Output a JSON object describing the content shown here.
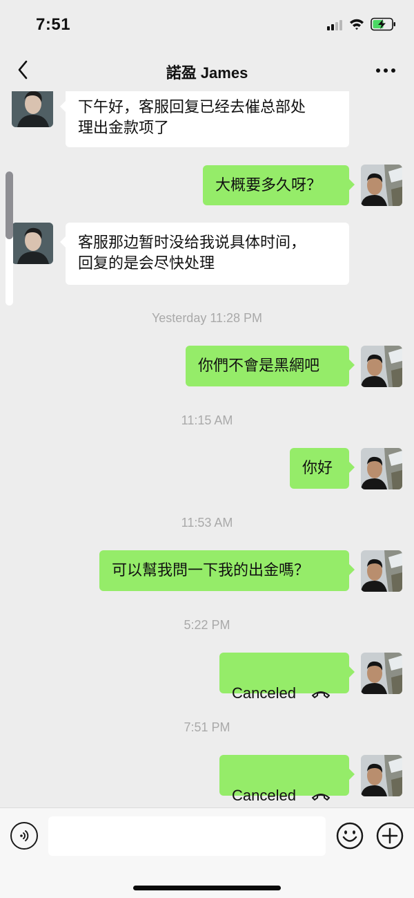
{
  "status_bar": {
    "time": "7:51"
  },
  "header": {
    "title": "諾盈 James"
  },
  "messages": [
    {
      "direction": "incoming",
      "text": "下午好，客服回复已经去催总部处\n理出金款项了"
    },
    {
      "direction": "outgoing",
      "text": "大概要多久呀？"
    },
    {
      "direction": "incoming",
      "text": "客服那边暂时没给我说具体时间，\n回复的是会尽快处理"
    },
    {
      "type": "timestamp",
      "text": "Yesterday 11:28 PM"
    },
    {
      "direction": "outgoing",
      "text": "你們不會是黑網吧"
    },
    {
      "type": "timestamp",
      "text": "11:15 AM"
    },
    {
      "direction": "outgoing",
      "text": "你好"
    },
    {
      "type": "timestamp",
      "text": "11:53 AM"
    },
    {
      "direction": "outgoing",
      "text": "可以幫我問一下我的出金嗎？"
    },
    {
      "type": "timestamp",
      "text": "5:22 PM"
    },
    {
      "direction": "outgoing",
      "type": "call",
      "text": "Canceled",
      "icon": "phone-hangup-icon"
    },
    {
      "type": "timestamp",
      "text": "7:51 PM"
    },
    {
      "direction": "outgoing",
      "type": "call",
      "text": "Canceled",
      "icon": "phone-hangup-icon"
    }
  ],
  "input_bar": {
    "placeholder": "",
    "value": ""
  },
  "colors": {
    "background": "#ededed",
    "outgoing_bubble": "#95ec69",
    "incoming_bubble": "#ffffff",
    "timestamp_text": "#a9a9a9"
  }
}
